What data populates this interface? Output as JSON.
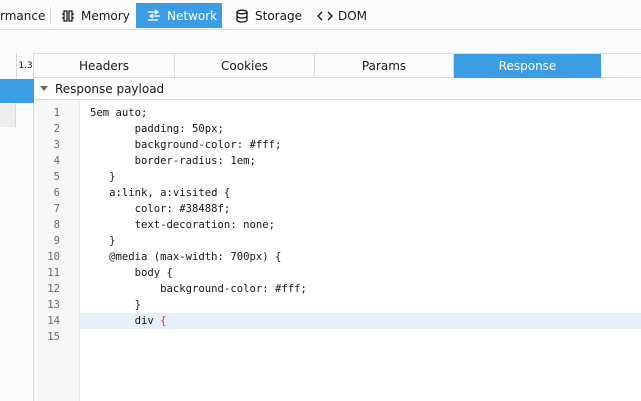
{
  "toolbar": {
    "tabs": [
      {
        "label": "rmance",
        "icon": ""
      },
      {
        "label": "Memory",
        "icon": "memory-icon"
      },
      {
        "label": "Network",
        "icon": "network-icon"
      },
      {
        "label": "Storage",
        "icon": "storage-icon"
      },
      {
        "label": "DOM",
        "icon": "dom-icon"
      }
    ],
    "active": "Network"
  },
  "request_list": {
    "visible_cell": "1.3"
  },
  "detail_tabs": {
    "tabs": [
      "Headers",
      "Cookies",
      "Params",
      "Response"
    ],
    "active": "Response"
  },
  "section": {
    "title": "Response payload"
  },
  "editor": {
    "current_line": 14,
    "lines": [
      {
        "num": "1",
        "code": "5em auto;"
      },
      {
        "num": "2",
        "code": "       padding: 50px;"
      },
      {
        "num": "3",
        "code": "       background-color: #fff;"
      },
      {
        "num": "4",
        "code": "       border-radius: 1em;"
      },
      {
        "num": "5",
        "code": "   }"
      },
      {
        "num": "6",
        "code": "   a:link, a:visited {"
      },
      {
        "num": "7",
        "code": "       color: #38488f;"
      },
      {
        "num": "8",
        "code": "       text-decoration: none;"
      },
      {
        "num": "9",
        "code": "   }"
      },
      {
        "num": "10",
        "code": "   @media (max-width: 700px) {"
      },
      {
        "num": "11",
        "code": "       body {"
      },
      {
        "num": "12",
        "code": "           background-color: #fff;"
      },
      {
        "num": "13",
        "code": "       }"
      },
      {
        "num": "14",
        "code": "       div ",
        "tail": "{"
      },
      {
        "num": "15",
        "code": ""
      }
    ]
  },
  "colors": {
    "accent": "#3c9de5",
    "current_line_bg": "#e7f1fb",
    "brace_highlight": "#e22f2f"
  }
}
